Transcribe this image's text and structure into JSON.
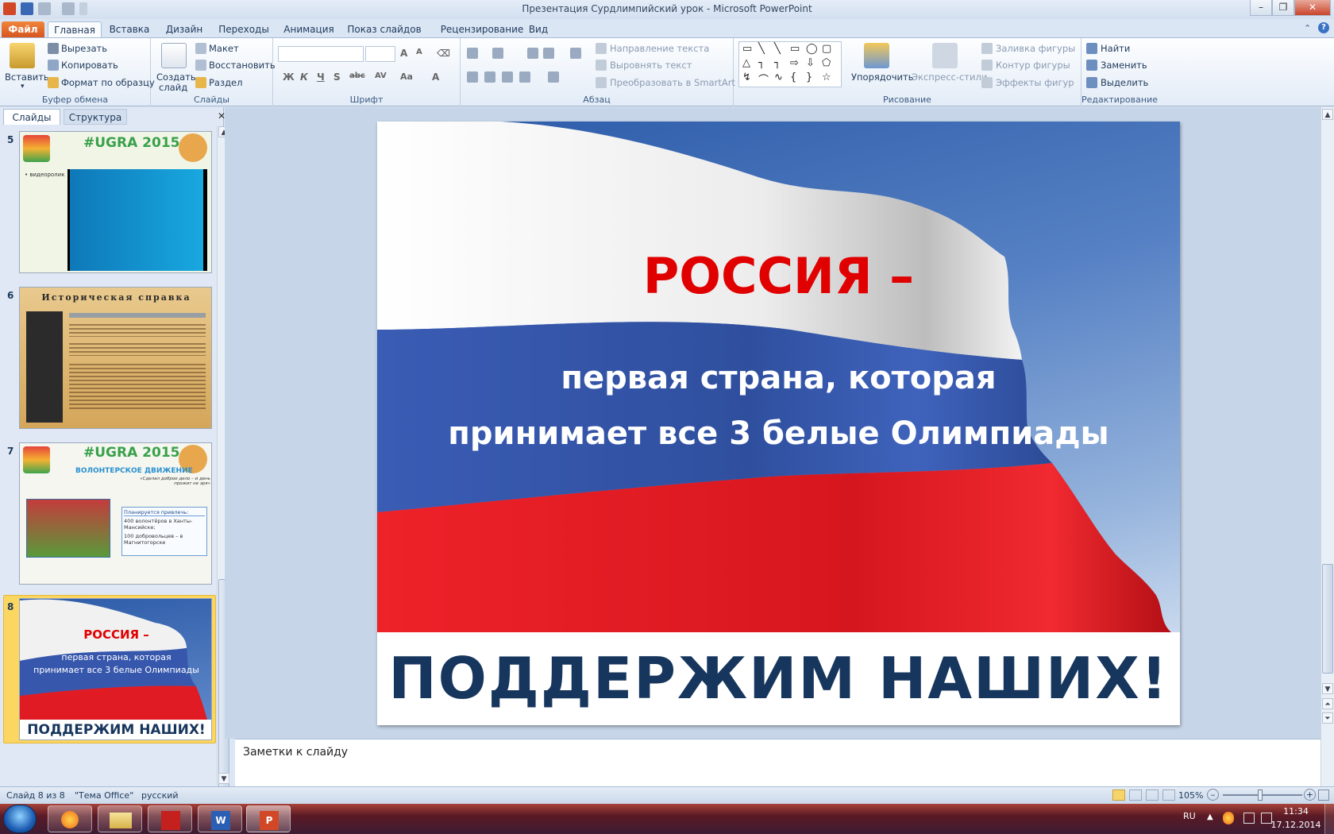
{
  "window": {
    "title": "Презентация Сурдлимпийский урок  -  Microsoft PowerPoint",
    "minimize": "–",
    "maximize": "❐",
    "close": "✕"
  },
  "tabs": [
    "Файл",
    "Главная",
    "Вставка",
    "Дизайн",
    "Переходы",
    "Анимация",
    "Показ слайдов",
    "Рецензирование",
    "Вид"
  ],
  "ribbon": {
    "clipboard": {
      "label": "Буфер обмена",
      "paste": "Вставить",
      "cut": "Вырезать",
      "copy": "Копировать",
      "format_painter": "Формат по образцу"
    },
    "slides": {
      "label": "Слайды",
      "new_slide_1": "Создать",
      "new_slide_2": "слайд",
      "layout": "Макет",
      "reset": "Восстановить",
      "section": "Раздел"
    },
    "font": {
      "label": "Шрифт",
      "bold": "Ж",
      "italic": "К",
      "underline": "Ч",
      "shadow": "S",
      "strike": "abc",
      "spacing": "AV",
      "case": "Aa",
      "color": "A"
    },
    "paragraph": {
      "label": "Абзац",
      "text_direction": "Направление текста",
      "align_text": "Выровнять текст",
      "smartart": "Преобразовать в SmartArt"
    },
    "drawing": {
      "label": "Рисование",
      "arrange": "Упорядочить",
      "quick_styles": "Экспресс-стили",
      "fill": "Заливка фигуры",
      "outline": "Контур фигуры",
      "effects": "Эффекты фигур"
    },
    "editing": {
      "label": "Редактирование",
      "find": "Найти",
      "replace": "Заменить",
      "select": "Выделить"
    }
  },
  "pane": {
    "tab_slides": "Слайды",
    "tab_outline": "Структура",
    "close": "✕"
  },
  "thumbnails": [
    {
      "num": "5",
      "title": "#UGRA 2015",
      "bullet": "• видеоролик"
    },
    {
      "num": "6",
      "title": "Историческая справка"
    },
    {
      "num": "7",
      "title": "#UGRA 2015",
      "subtitle": "ВОЛОНТЕРСКОЕ ДВИЖЕНИЕ",
      "quote": "«Сделал доброе дело – и день прожит не зря»",
      "plan": "Планируется привлечь:",
      "p1": "400 волонтёров в Ханты-Мансийске;",
      "p2": "100 добровольцев – в Магнитогорске"
    },
    {
      "num": "8",
      "line1": "РОССИЯ –",
      "line2": "первая страна, которая",
      "line3": "принимает все 3 белые Олимпиады",
      "footer": "ПОДДЕРЖИМ НАШИХ!"
    }
  ],
  "slide": {
    "heading": "РОССИЯ –",
    "line2": "первая страна, которая",
    "line3": "принимает все 3 белые Олимпиады",
    "footer": "ПОДДЕРЖИМ НАШИХ!"
  },
  "notes_placeholder": "Заметки к слайду",
  "status": {
    "slide_counter": "Слайд 8 из 8",
    "theme": "\"Тема Office\"",
    "language": "русский",
    "zoom": "105%",
    "zoom_minus": "–",
    "zoom_plus": "+"
  },
  "taskbar": {
    "lang": "RU",
    "time": "11:34",
    "date": "17.12.2014"
  },
  "colors": {
    "accent_file_tab": "#e0612a",
    "flag_white": "#f2f2f2",
    "flag_blue": "#3557b0",
    "flag_red": "#e31c25",
    "heading_red": "#e00000",
    "footer_navy": "#17365d",
    "selection": "#fbd660"
  }
}
